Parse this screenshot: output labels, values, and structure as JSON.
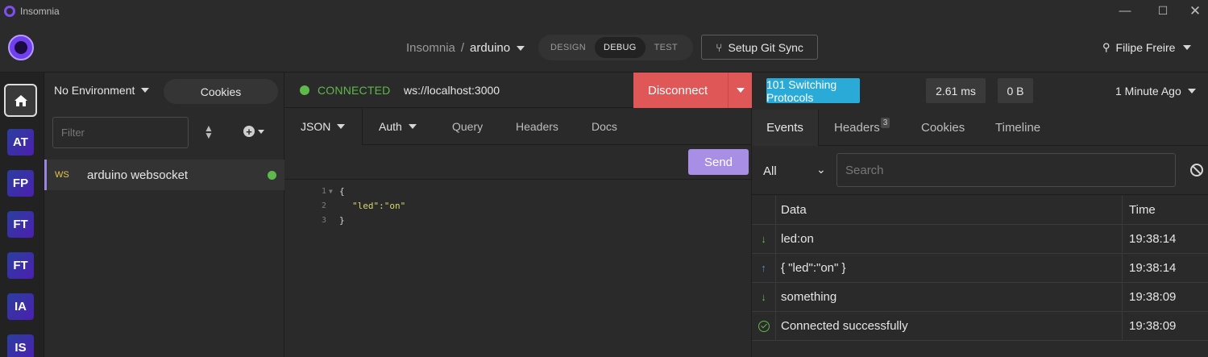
{
  "window": {
    "title": "Insomnia",
    "min": "—",
    "max": "☐",
    "close": "✕"
  },
  "header": {
    "workspace": "Insomnia",
    "separator": "/",
    "project": "arduino",
    "modes": [
      "DESIGN",
      "DEBUG",
      "TEST"
    ],
    "active_mode": "DEBUG",
    "git_sync": "Setup Git Sync",
    "user": "Filipe Freire"
  },
  "rail": {
    "items": [
      "AT",
      "FP",
      "FT",
      "FT",
      "IA",
      "IS"
    ]
  },
  "sidebar": {
    "environment": "No Environment",
    "cookies": "Cookies",
    "filter_placeholder": "Filter",
    "requests": [
      {
        "method": "WS",
        "name": "arduino websocket",
        "status_color": "#5fb84a"
      }
    ]
  },
  "request": {
    "status": "CONNECTED",
    "url": "ws://localhost:3000",
    "disconnect": "Disconnect",
    "tabs": [
      "JSON",
      "Auth",
      "Query",
      "Headers",
      "Docs"
    ],
    "send": "Send",
    "body_lines": [
      "{",
      "\"led\":\"on\"",
      "}"
    ],
    "line_numbers": [
      "1",
      "2",
      "3"
    ]
  },
  "response": {
    "status": "101 Switching Protocols",
    "time": "2.61 ms",
    "size": "0 B",
    "age": "1 Minute Ago",
    "tabs": [
      "Events",
      "Headers",
      "Cookies",
      "Timeline"
    ],
    "headers_count": "3",
    "filter_value": "All",
    "search_placeholder": "Search",
    "columns": {
      "data": "Data",
      "time": "Time"
    },
    "events": [
      {
        "direction": "down-arrow-icon",
        "data": "led:on",
        "time": "19:38:14"
      },
      {
        "direction": "up-arrow-icon",
        "data": "{ \"led\":\"on\" }",
        "time": "19:38:14"
      },
      {
        "direction": "down-arrow-icon",
        "data": "something",
        "time": "19:38:09"
      },
      {
        "direction": "check-circle-icon",
        "data": "Connected successfully",
        "time": "19:38:09"
      }
    ]
  },
  "colors": {
    "accent": "#7e4ff0",
    "connected": "#5fb84a",
    "disconnect": "#e05757",
    "status_badge": "#2aaad6",
    "send": "#a98ee6"
  }
}
